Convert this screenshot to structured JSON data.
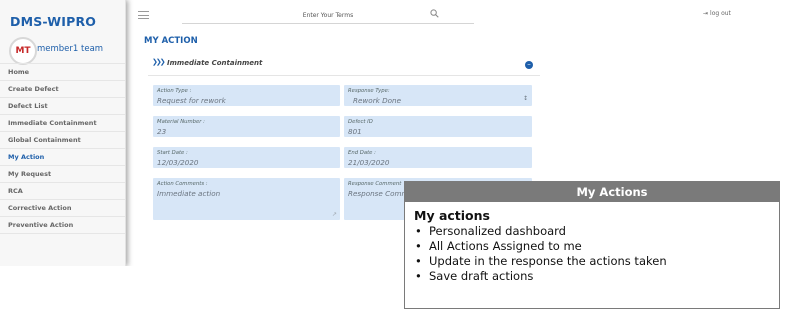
{
  "app": {
    "brand": "DMS-WIPRO"
  },
  "user": {
    "initials": "MT",
    "name": "member1 team"
  },
  "nav": {
    "items": [
      {
        "label": "Home",
        "active": false
      },
      {
        "label": "Create Defect",
        "active": false
      },
      {
        "label": "Defect List",
        "active": false
      },
      {
        "label": "Immediate Containment",
        "active": false
      },
      {
        "label": "Global Containment",
        "active": false
      },
      {
        "label": "My Action",
        "active": true
      },
      {
        "label": "My Request",
        "active": false
      },
      {
        "label": "RCA",
        "active": false
      },
      {
        "label": "Corrective Action",
        "active": false
      },
      {
        "label": "Preventive Action",
        "active": false
      }
    ]
  },
  "topbar": {
    "search_placeholder": "Enter Your Terms",
    "logout_label": "log out",
    "icons": {
      "menu": "hamburger-icon",
      "search": "search-icon",
      "logout": "logout-icon"
    }
  },
  "main": {
    "page_title": "MY ACTION",
    "section_title": "Immediate Containment",
    "section_icons": {
      "lead": "double-chevron-icon",
      "toggle": "collapse-icon"
    },
    "fields": {
      "action_type": {
        "label": "Action Type :",
        "value": "Request for rework"
      },
      "response_type": {
        "label": "Response Type:",
        "value": "Rework Done"
      },
      "material_number": {
        "label": "Material Number :",
        "value": "23"
      },
      "defect_id": {
        "label": "Defect ID",
        "value": "801"
      },
      "start_date": {
        "label": "Start Date :",
        "value": "12/03/2020"
      },
      "end_date": {
        "label": "End Date :",
        "value": "21/03/2020"
      },
      "action_comments": {
        "label": "Action Comments :",
        "value": "Immediate action"
      },
      "response_comments": {
        "label": "Response Comment",
        "value": "Response Comme"
      }
    }
  },
  "overlay": {
    "header": "My Actions",
    "heading": "My actions",
    "bullets": [
      "Personalized dashboard",
      "All Actions Assigned to me",
      "Update in the response the actions taken",
      "Save draft actions"
    ]
  },
  "colors": {
    "accent": "#1e5faa",
    "field_bg": "#d7e6f7",
    "overlay_header": "#7a7a7a"
  }
}
